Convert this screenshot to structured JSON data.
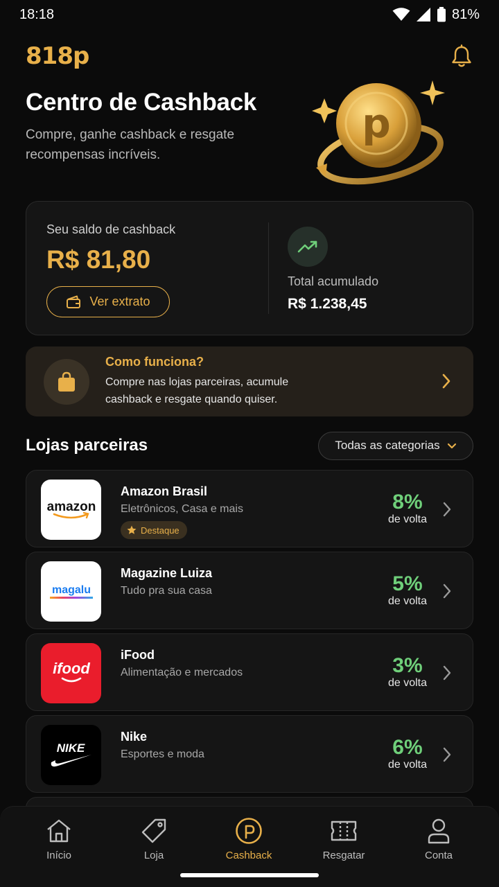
{
  "status": {
    "time": "18:18",
    "battery": "81%"
  },
  "header": {
    "logo": "818p"
  },
  "hero": {
    "title": "Centro de Cashback",
    "subtitle_line1": "Compre, ganhe cashback e resgate",
    "subtitle_line2": "recompensas incríveis."
  },
  "balance": {
    "label": "Seu saldo de cashback",
    "value": "R$ 81,80",
    "button": "Ver extrato",
    "total_label": "Total acumulado",
    "total_value": "R$ 1.238,45"
  },
  "how": {
    "title": "Como funciona?",
    "desc_line1": "Compre nas lojas parceiras, acumule",
    "desc_line2": "cashback e resgate quando quiser."
  },
  "stores_section": {
    "title": "Lojas parceiras",
    "filter": "Todas as categorias"
  },
  "stores": [
    {
      "name": "Amazon Brasil",
      "category": "Eletrônicos, Casa e mais",
      "badge": "Destaque",
      "rate": "8%",
      "rate_label": "de volta",
      "logo_text": "amazon"
    },
    {
      "name": "Magazine Luiza",
      "category": "Tudo pra sua casa",
      "rate": "5%",
      "rate_label": "de volta",
      "logo_text": "magalu"
    },
    {
      "name": "iFood",
      "category": "Alimentação e mercados",
      "rate": "3%",
      "rate_label": "de volta",
      "logo_text": "ifood"
    },
    {
      "name": "Nike",
      "category": "Esportes e moda",
      "rate": "6%",
      "rate_label": "de volta",
      "logo_text": "NIKE"
    }
  ],
  "nav": [
    {
      "label": "Início",
      "icon": "home-icon"
    },
    {
      "label": "Loja",
      "icon": "tag-icon"
    },
    {
      "label": "Cashback",
      "icon": "cashback-coin-icon",
      "active": true
    },
    {
      "label": "Resgatar",
      "icon": "ticket-icon"
    },
    {
      "label": "Conta",
      "icon": "user-icon"
    }
  ],
  "colors": {
    "accent": "#e8b04a",
    "rate_green": "#6fcf7a",
    "background": "#0b0b0b"
  }
}
